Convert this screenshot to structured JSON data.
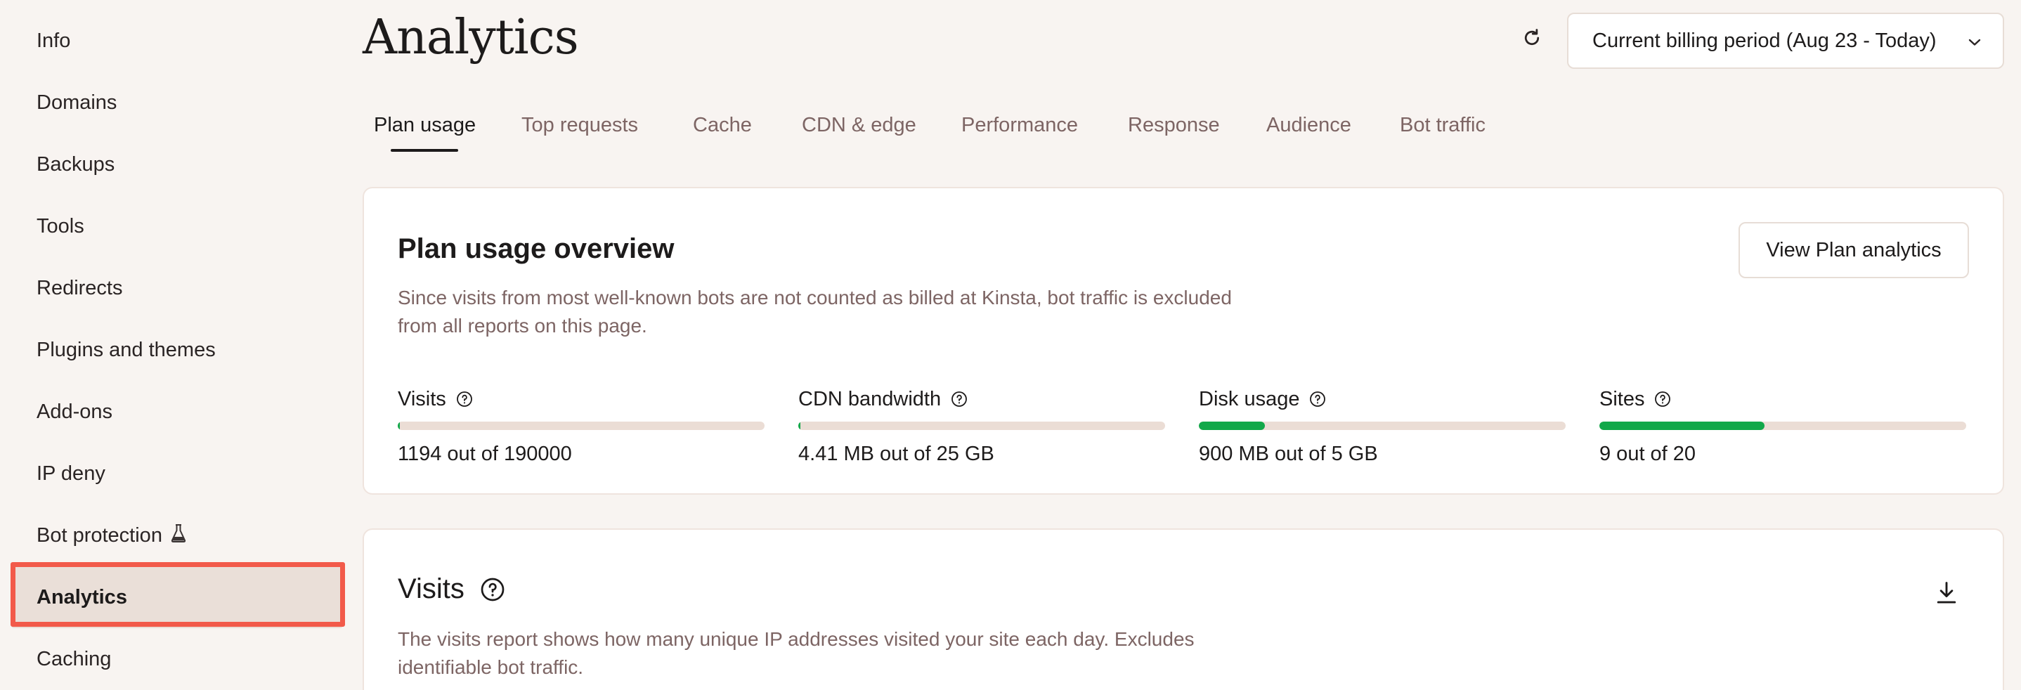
{
  "sidebar": {
    "items": [
      {
        "label": "Info"
      },
      {
        "label": "Domains"
      },
      {
        "label": "Backups"
      },
      {
        "label": "Tools"
      },
      {
        "label": "Redirects"
      },
      {
        "label": "Plugins and themes"
      },
      {
        "label": "Add-ons"
      },
      {
        "label": "IP deny"
      },
      {
        "label": "Bot protection",
        "icon": "flask-icon"
      },
      {
        "label": "Analytics",
        "active": true
      },
      {
        "label": "Caching"
      }
    ]
  },
  "header": {
    "title": "Analytics",
    "refresh_icon": "refresh-icon",
    "period_select": {
      "value": "Current billing period (Aug 23 - Today)",
      "icon": "chevron-down-icon"
    }
  },
  "tabs": [
    {
      "label": "Plan usage",
      "active": true
    },
    {
      "label": "Top requests"
    },
    {
      "label": "Cache"
    },
    {
      "label": "CDN & edge"
    },
    {
      "label": "Performance"
    },
    {
      "label": "Response"
    },
    {
      "label": "Audience"
    },
    {
      "label": "Bot traffic"
    }
  ],
  "plan_usage": {
    "title": "Plan usage overview",
    "description_line1": "Since visits from most well-known bots are not counted as billed at Kinsta, bot traffic is excluded",
    "description_line2": "from all reports on this page.",
    "view_button": "View Plan analytics",
    "metrics": [
      {
        "label": "Visits",
        "value": "1194 out of 190000",
        "fraction": 0.0063
      },
      {
        "label": "CDN bandwidth",
        "value": "4.41 MB out of 25 GB",
        "fraction": 0.0002
      },
      {
        "label": "Disk usage",
        "value": "900 MB out of 5 GB",
        "fraction": 0.18
      },
      {
        "label": "Sites",
        "value": "9 out of 20",
        "fraction": 0.45
      }
    ]
  },
  "visits": {
    "title": "Visits",
    "description_line1": "The visits report shows how many unique IP addresses visited your site each day. Excludes",
    "description_line2": "identifiable bot traffic.",
    "download_icon": "download-icon"
  },
  "colors": {
    "accent_green": "#12a84a",
    "highlight_red": "#f25a4a",
    "muted_text": "#7d6564",
    "background": "#f8f4f1"
  }
}
